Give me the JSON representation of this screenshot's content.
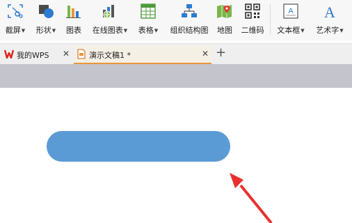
{
  "toolbar": {
    "items": [
      {
        "label": "截屏",
        "dropdown": true,
        "icon": "screenshot-icon"
      },
      {
        "label": "形状",
        "dropdown": true,
        "icon": "shapes-icon"
      },
      {
        "label": "图表",
        "dropdown": false,
        "icon": "chart-icon"
      },
      {
        "label": "在线图表",
        "dropdown": true,
        "icon": "online-chart-icon"
      },
      {
        "label": "表格",
        "dropdown": true,
        "icon": "table-icon"
      },
      {
        "label": "组织结构图",
        "dropdown": false,
        "icon": "org-chart-icon"
      },
      {
        "label": "地图",
        "dropdown": false,
        "icon": "map-icon"
      },
      {
        "label": "二维码",
        "dropdown": false,
        "icon": "qrcode-icon"
      },
      {
        "label": "文本框",
        "dropdown": true,
        "icon": "textbox-icon"
      },
      {
        "label": "艺术字",
        "dropdown": true,
        "icon": "wordart-icon"
      }
    ]
  },
  "tabs": [
    {
      "label": "我的WPS",
      "active": false,
      "icon": "wps-logo-icon"
    },
    {
      "label": "演示文稿1 *",
      "active": true,
      "icon": "presentation-file-icon"
    }
  ],
  "colors": {
    "shape_fill": "#5b9bd5",
    "arrow": "#e8312f",
    "tab_accent": "#e8963c",
    "strip": "#c4c4cc"
  }
}
